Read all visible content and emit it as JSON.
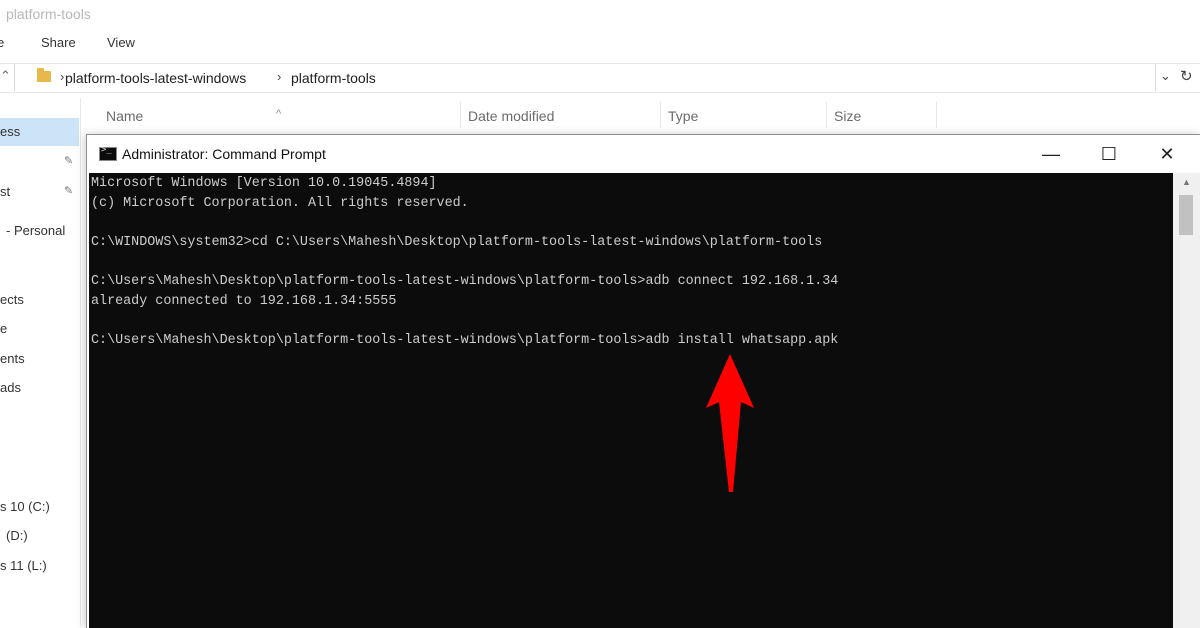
{
  "explorer": {
    "title": "platform-tools",
    "ribbon": [
      "e",
      "Share",
      "View"
    ],
    "address": {
      "crumbs": [
        "platform-tools-latest-windows",
        "platform-tools"
      ]
    },
    "columns": [
      "Name",
      "Date modified",
      "Type",
      "Size"
    ],
    "nav_items": [
      {
        "label": "ess",
        "pinned": false
      },
      {
        "label": "",
        "pinned": true
      },
      {
        "label": "st",
        "pinned": true
      },
      {
        "label": "- Personal",
        "pinned": false
      },
      {
        "label": "ects",
        "pinned": false
      },
      {
        "label": "e",
        "pinned": false
      },
      {
        "label": "ents",
        "pinned": false
      },
      {
        "label": "ads",
        "pinned": false
      },
      {
        "label": "s 10 (C:)",
        "pinned": false
      },
      {
        "label": "(D:)",
        "pinned": false
      },
      {
        "label": "s 11 (L:)",
        "pinned": false
      }
    ]
  },
  "cmd": {
    "title": "Administrator: Command Prompt",
    "buttons": {
      "minimize": "—",
      "maximize": "☐",
      "close": "✕"
    },
    "lines": [
      "Microsoft Windows [Version 10.0.19045.4894]",
      "(c) Microsoft Corporation. All rights reserved.",
      "",
      "C:\\WINDOWS\\system32>cd C:\\Users\\Mahesh\\Desktop\\platform-tools-latest-windows\\platform-tools",
      "",
      "C:\\Users\\Mahesh\\Desktop\\platform-tools-latest-windows\\platform-tools>adb connect 192.168.1.34",
      "already connected to 192.168.1.34:5555",
      "",
      "C:\\Users\\Mahesh\\Desktop\\platform-tools-latest-windows\\platform-tools>adb install whatsapp.apk"
    ]
  },
  "colors": {
    "console_bg": "#0c0c0c",
    "console_text": "#cccccc",
    "arrow": "#ff0000",
    "selection": "#cce4f7",
    "folder": "#e8b84a"
  },
  "icons": {
    "address_folder": "folder-icon",
    "cmd_icon": "command-prompt-icon",
    "annotation": "red-arrow-icon"
  }
}
